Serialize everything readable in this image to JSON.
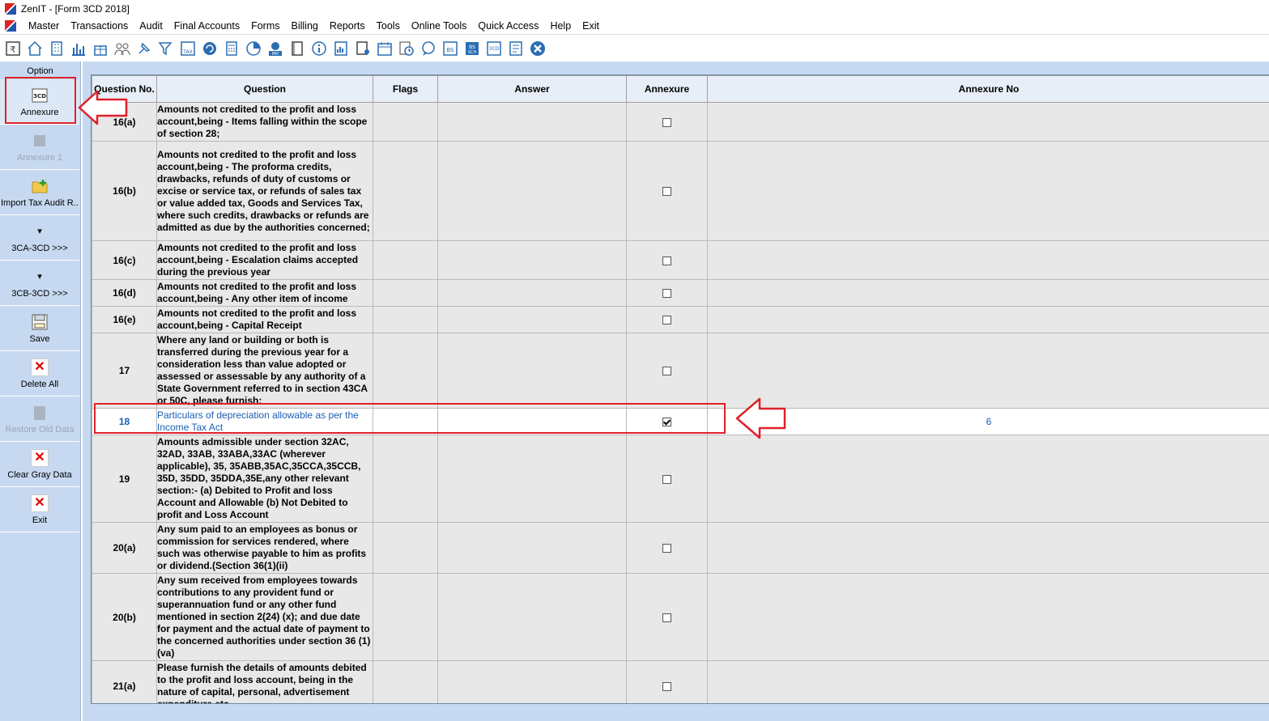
{
  "window": {
    "title": "ZenIT - [Form 3CD 2018]"
  },
  "menu": [
    "Master",
    "Transactions",
    "Audit",
    "Final Accounts",
    "Forms",
    "Billing",
    "Reports",
    "Tools",
    "Online Tools",
    "Quick Access",
    "Help",
    "Exit"
  ],
  "toolbar": {
    "icons": [
      "rupee-book-icon",
      "home-icon",
      "building-icon",
      "bar-chart-icon",
      "gift-icon",
      "users-icon",
      "pin-icon",
      "filter-icon",
      "tax-icon",
      "refresh-icon",
      "calculator-icon",
      "pie-chart-icon",
      "pay-icon",
      "book-icon",
      "info-icon",
      "report-icon",
      "user-doc-icon",
      "calendar-icon",
      "clock-icon",
      "chat-icon",
      "bs-icon",
      "bs-sch-icon",
      "3cd-icon",
      "form-icon",
      "close-icon"
    ],
    "labels": {
      "tax": "TAX",
      "pay": "PAY",
      "bs": "BS",
      "bs_sch": "BS",
      "sch": "SCH",
      "cd3": "3CD"
    }
  },
  "sidebar": {
    "title": "Option",
    "buttons": [
      {
        "label": "Annexure",
        "icon_text": "3CD",
        "enabled": true
      },
      {
        "label": "Annexure 1",
        "enabled": false
      },
      {
        "label": "Import Tax Audit R...",
        "enabled": true
      },
      {
        "label": "3CA-3CD >>>",
        "enabled": true
      },
      {
        "label": "3CB-3CD >>>",
        "enabled": true
      },
      {
        "label": "Save",
        "enabled": true
      },
      {
        "label": "Delete All",
        "enabled": true
      },
      {
        "label": "Restore Old Data",
        "enabled": false
      },
      {
        "label": "Clear Gray Data",
        "enabled": true
      },
      {
        "label": "Exit",
        "enabled": true
      }
    ]
  },
  "grid": {
    "columns": [
      "Question No.",
      "Question",
      "Flags",
      "Answer",
      "Annexure",
      "Annexure No"
    ],
    "rows": [
      {
        "no": "16(a)",
        "question": "Amounts not credited to the profit and loss account,being - Items falling within the scope of section 28;",
        "annexure": false,
        "annexure_no": ""
      },
      {
        "no": "16(b)",
        "question": "Amounts not credited to the profit and loss account,being - The proforma credits, drawbacks, refunds of duty of customs or excise or service tax, or refunds  of sales tax or value added tax, Goods and Services Tax, where such credits, drawbacks or refunds are admitted as due by the authorities concerned;",
        "annexure": false,
        "annexure_no": ""
      },
      {
        "no": "16(c)",
        "question": "Amounts not credited to the profit and loss account,being - Escalation claims accepted during the previous  year",
        "annexure": false,
        "annexure_no": ""
      },
      {
        "no": "16(d)",
        "question": "Amounts not credited to the profit and loss account,being - Any other item of income",
        "annexure": false,
        "annexure_no": ""
      },
      {
        "no": "16(e)",
        "question": "Amounts not credited to the profit and loss account,being - Capital Receipt",
        "annexure": false,
        "annexure_no": ""
      },
      {
        "no": "17",
        "question": "Where any land or building or both is transferred during the previous year for a consideration less than value adopted or assessed or assessable by any authority of a State Government referred to in section 43CA or 50C, please furnish:",
        "annexure": false,
        "annexure_no": ""
      },
      {
        "no": "18",
        "question": "Particulars of depreciation allowable as per the Income Tax Act",
        "annexure": true,
        "annexure_no": "6"
      },
      {
        "no": "19",
        "question": "Amounts admissible under section 32AC, 32AD, 33AB, 33ABA,33AC (wherever applicable), 35, 35ABB,35AC,35CCA,35CCB, 35D, 35DD, 35DDA,35E,any other relevant section:- (a) Debited to Profit and loss Account and Allowable (b) Not Debited to profit and Loss Account",
        "annexure": false,
        "annexure_no": ""
      },
      {
        "no": "20(a)",
        "question": "Any sum paid to an employees as bonus or commission for services rendered, where such was otherwise payable to him as profits or dividend.(Section 36(1)(ii)",
        "annexure": false,
        "annexure_no": ""
      },
      {
        "no": "20(b)",
        "question": "Any sum received from employees towards contributions to any provident fund or superannuation fund or any other fund mentioned in section 2(24) (x); and due date for payment and the actual date of payment to the concerned authorities under section 36 (1)(va)",
        "annexure": false,
        "annexure_no": ""
      },
      {
        "no": "21(a)",
        "question": "Please furnish the details of amounts debited to the profit and loss account, being in the nature of capital, personal, advertisement expenditure etc.",
        "annexure": false,
        "annexure_no": ""
      }
    ]
  }
}
